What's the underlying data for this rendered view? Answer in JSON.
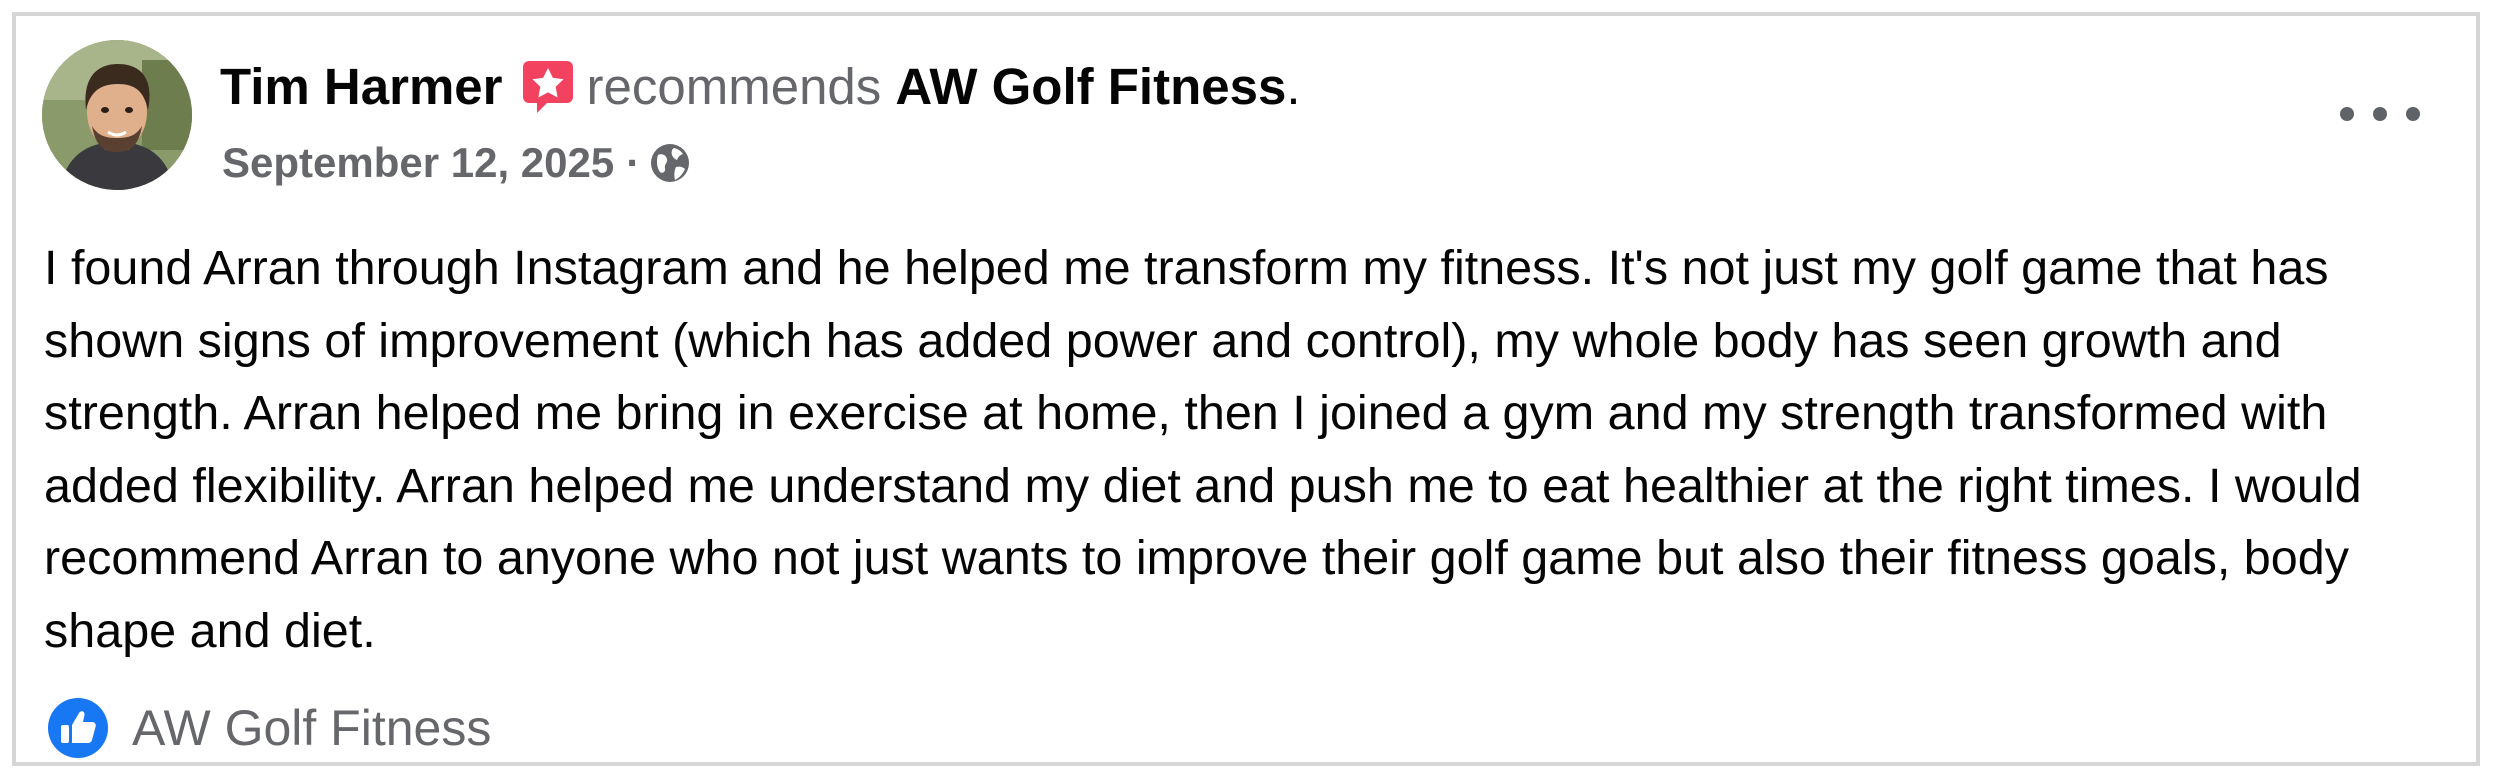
{
  "post": {
    "author": "Tim Harmer",
    "verb": "recommends",
    "page_name": "AW Golf Fitness",
    "period": ".",
    "date": "September 12, 2025",
    "separator": "·",
    "audience_icon": "globe-icon",
    "recommend_badge_icon": "star-badge-icon",
    "more_icon": "more-options-icon",
    "review_text": "I found Arran through Instagram and he helped me transform my fitness. It's not just my golf game that has shown signs of improvement (which has added power and control), my whole body has seen growth and strength. Arran helped me bring in exercise at home, then I joined a gym and my strength transformed with added flexibility. Arran helped me understand my diet and push me to eat healthier at the right times. I would recommend Arran to anyone who not just wants to improve their golf game but also their fitness goals, body shape and diet."
  },
  "footer": {
    "icon": "like-icon",
    "page_name": "AW Golf Fitness"
  },
  "colors": {
    "badge": "#f3425f",
    "like_blue": "#1877f2",
    "secondary_text": "#65676b",
    "primary_text": "#050505",
    "border": "#d6d6d6"
  }
}
